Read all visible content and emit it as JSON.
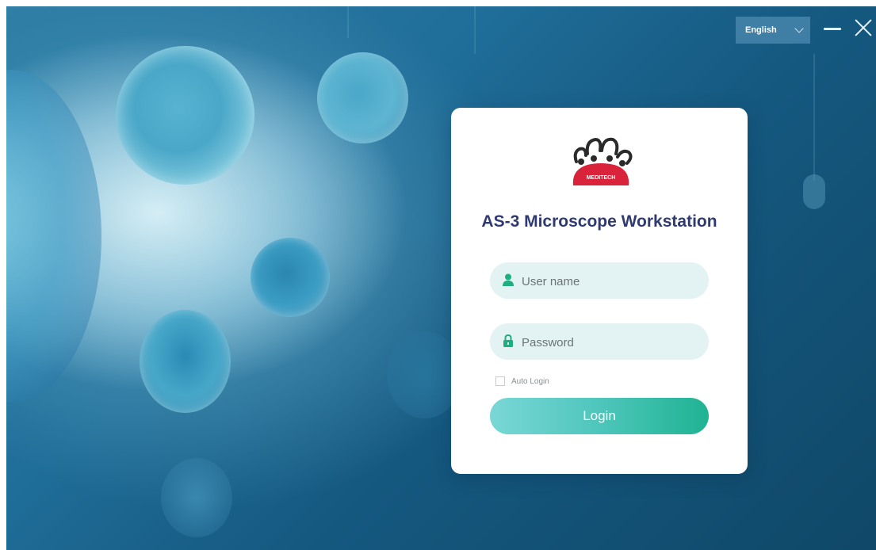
{
  "window": {
    "language": {
      "selected": "English",
      "icon": "chevron-down-icon"
    },
    "controls": {
      "minimize_icon": "minimize-icon",
      "close_icon": "close-icon"
    }
  },
  "login_card": {
    "logo": {
      "brand_text": "MEDITECH",
      "icon": "meditech-logo"
    },
    "title": "AS-3 Microscope Workstation",
    "username": {
      "placeholder": "User name",
      "value": "",
      "icon": "user-icon"
    },
    "password": {
      "placeholder": "Password",
      "value": "",
      "icon": "lock-icon"
    },
    "auto_login": {
      "label": "Auto Login",
      "checked": false
    },
    "login_button": "Login"
  },
  "colors": {
    "title": "#2f3a72",
    "field_bg": "#e3f2f2",
    "icon_green": "#1fae7f",
    "button_start": "#7ad7d5",
    "button_end": "#1fb393",
    "logo_red": "#d9233b"
  }
}
